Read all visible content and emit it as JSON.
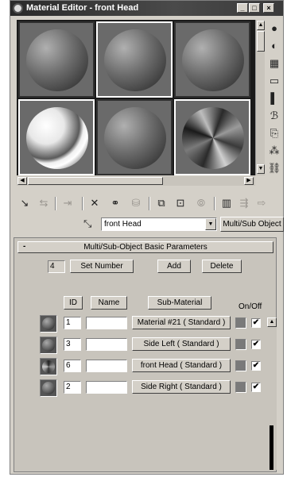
{
  "window": {
    "title": "Material Editor - front Head",
    "controls": {
      "minimize": "_",
      "maximize": "□",
      "close": "×"
    }
  },
  "slots": [
    {
      "label": "slot-1",
      "kind": "gray-sphere"
    },
    {
      "label": "slot-2",
      "kind": "gray-sphere"
    },
    {
      "label": "slot-3",
      "kind": "gray-sphere"
    },
    {
      "label": "slot-4",
      "kind": "striped-sphere"
    },
    {
      "label": "slot-5",
      "kind": "gray-sphere"
    },
    {
      "label": "slot-6",
      "kind": "textured-sphere"
    }
  ],
  "side_tools": [
    {
      "icon": "sample-type-sphere-icon",
      "glyph": "●"
    },
    {
      "icon": "backlight-icon",
      "glyph": "◐"
    },
    {
      "icon": "checker-background-icon",
      "glyph": "▦"
    },
    {
      "icon": "sample-uv-tiling-icon",
      "glyph": "▭"
    },
    {
      "icon": "video-color-check-icon",
      "glyph": "▌"
    },
    {
      "icon": "make-preview-icon",
      "glyph": "ℬ"
    },
    {
      "icon": "options-icon",
      "glyph": "⎘"
    },
    {
      "icon": "select-by-material-icon",
      "glyph": "⁂"
    },
    {
      "icon": "material-map-navigator-icon",
      "glyph": "⛓"
    }
  ],
  "toolbar": [
    {
      "icon": "get-material-icon",
      "glyph": "↘",
      "dim": false
    },
    {
      "icon": "put-material-to-scene-icon",
      "glyph": "⇆",
      "dim": true
    },
    {
      "icon": "assign-material-icon",
      "glyph": "⇥",
      "dim": true
    },
    {
      "icon": "reset-map-icon",
      "glyph": "✕",
      "dim": false
    },
    {
      "icon": "make-unique-icon",
      "glyph": "⚭",
      "dim": false
    },
    {
      "icon": "put-to-library-icon",
      "glyph": "⛁",
      "dim": true
    },
    {
      "icon": "material-effects-channel-icon",
      "glyph": "⧉",
      "dim": false
    },
    {
      "icon": "show-map-in-viewport-icon",
      "glyph": "⊡",
      "dim": false
    },
    {
      "icon": "show-end-result-icon",
      "glyph": "⦾",
      "dim": true
    },
    {
      "icon": "go-to-parent-icon",
      "glyph": "▥",
      "dim": false
    },
    {
      "icon": "go-forward-to-sibling-icon",
      "glyph": "⇶",
      "dim": true
    },
    {
      "icon": "go-sibling-icon",
      "glyph": "⇨",
      "dim": true
    }
  ],
  "name_row": {
    "pick_icon": "pick-material-from-object-icon",
    "material_name": "front Head",
    "type_button": "Multi/Sub Object"
  },
  "rollout": {
    "title": "Multi/Sub-Object Basic Parameters",
    "collapse": "-",
    "count": "4",
    "set_number": "Set Number",
    "add": "Add",
    "delete": "Delete",
    "col_id": "ID",
    "col_name": "Name",
    "col_sub": "Sub-Material",
    "col_onoff": "On/Off",
    "rows": [
      {
        "id": "1",
        "name": "",
        "sub": "Material #21  ( Standard )",
        "on": "✔",
        "kind": "plain"
      },
      {
        "id": "3",
        "name": "",
        "sub": "Side Left  ( Standard )",
        "on": "✔",
        "kind": "plain"
      },
      {
        "id": "6",
        "name": "",
        "sub": "front Head  ( Standard )",
        "on": "✔",
        "kind": "textured"
      },
      {
        "id": "2",
        "name": "",
        "sub": "Side Right  ( Standard )",
        "on": "✔",
        "kind": "plain"
      }
    ]
  }
}
